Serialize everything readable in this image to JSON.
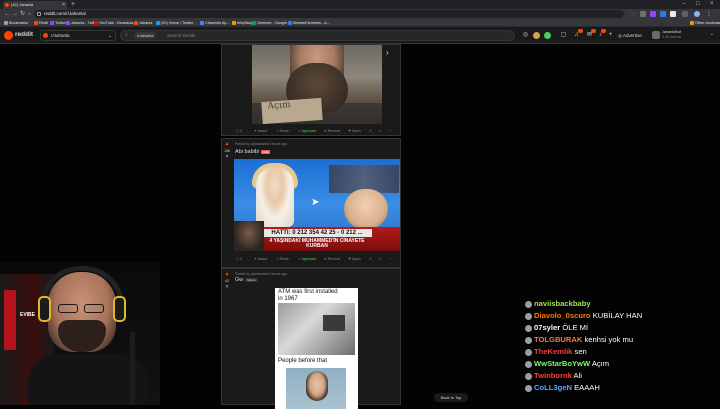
{
  "browser": {
    "tab_title": "(42) Jahanla",
    "url": "reddit.com/r/Jahanla/",
    "bookmarks": [
      {
        "label": "Bookmarks",
        "color": "#9aa0a6"
      },
      {
        "label": "Redit",
        "color": "#ff4500"
      },
      {
        "label": "Twitch",
        "color": "#9146ff"
      },
      {
        "label": "Jahanla - Twitch",
        "color": "#9146ff"
      },
      {
        "label": "YouTube - Broadcas...",
        "color": "#ff0000"
      },
      {
        "label": "Jahanla",
        "color": "#ff4500"
      },
      {
        "label": "(20) Home / Twitter",
        "color": "#1d9bf0"
      },
      {
        "label": "Channels Ap...",
        "color": "#4285f4"
      },
      {
        "label": "reby2kay",
        "color": "#f29900"
      },
      {
        "label": "Onenote - Google D...",
        "color": "#0f9d58"
      },
      {
        "label": "StreamElements - A...",
        "color": "#2b7de9"
      },
      {
        "label": "Other bookmarks",
        "color": "#f29900"
      }
    ]
  },
  "header": {
    "logo": "reddit",
    "community": "r/Jahanla",
    "search_chip": "r/Jahanla",
    "search_placeholder": "Search Reddit",
    "advertise": "Advertise",
    "username": "JahanlaBot",
    "karma": "2.1k karma"
  },
  "posts": [
    {
      "score": "",
      "actions": [
        "0",
        "Award",
        "Share",
        "Approved",
        "Remove",
        "Spam"
      ]
    },
    {
      "meta": "Posted by u/jahanlabot  5 hours ago",
      "score": "136",
      "title": "Abi babibi",
      "tag": "nsfw",
      "tv_phone": "HATTI: 0 212 354 42 25 - 0 212 ...",
      "tv_ticker": "4 YAŞINDAKİ MUHAMMED'İN CİNAYETE KURBAN",
      "actions": [
        "0",
        "Award",
        "Share",
        "Approved",
        "Remove",
        "Spam"
      ]
    },
    {
      "meta": "Posted by u/jahanlabot  5 hours ago",
      "score": "42",
      "title": "Gw",
      "flair": "Meme",
      "meme_top": "ATM was first installed in 1967",
      "meme_bottom": "People before that"
    }
  ],
  "chat": [
    {
      "user": "naviisbackbaby",
      "color": "#a3e157",
      "msg": ""
    },
    {
      "user": "Diavolo_0scuro",
      "color": "#ff7b00",
      "msg": "KUBİLAY HAN"
    },
    {
      "user": "07syler",
      "color": "#ffffff",
      "msg": "ÖLE Mİ"
    },
    {
      "user": "TOLGBURAK",
      "color": "#ff7a3d",
      "msg": "kenhsi yok mu"
    },
    {
      "user": "TheKemlik",
      "color": "#ff3b3b",
      "msg": "sen"
    },
    {
      "user": "WwStarBoYwW",
      "color": "#7dff63",
      "msg": "Açım"
    },
    {
      "user": "Twinbornk",
      "color": "#ff4040",
      "msg": "Ali"
    },
    {
      "user": "CoLL3geN",
      "color": "#58a6ff",
      "msg": "EAAAH"
    }
  ],
  "back_to_top": "Back to Top",
  "webcam": {
    "chair_brand": "EVIBE"
  },
  "colors": {
    "accent": "#ff4500",
    "bg": "#030303",
    "card": "#1a1a1b"
  }
}
